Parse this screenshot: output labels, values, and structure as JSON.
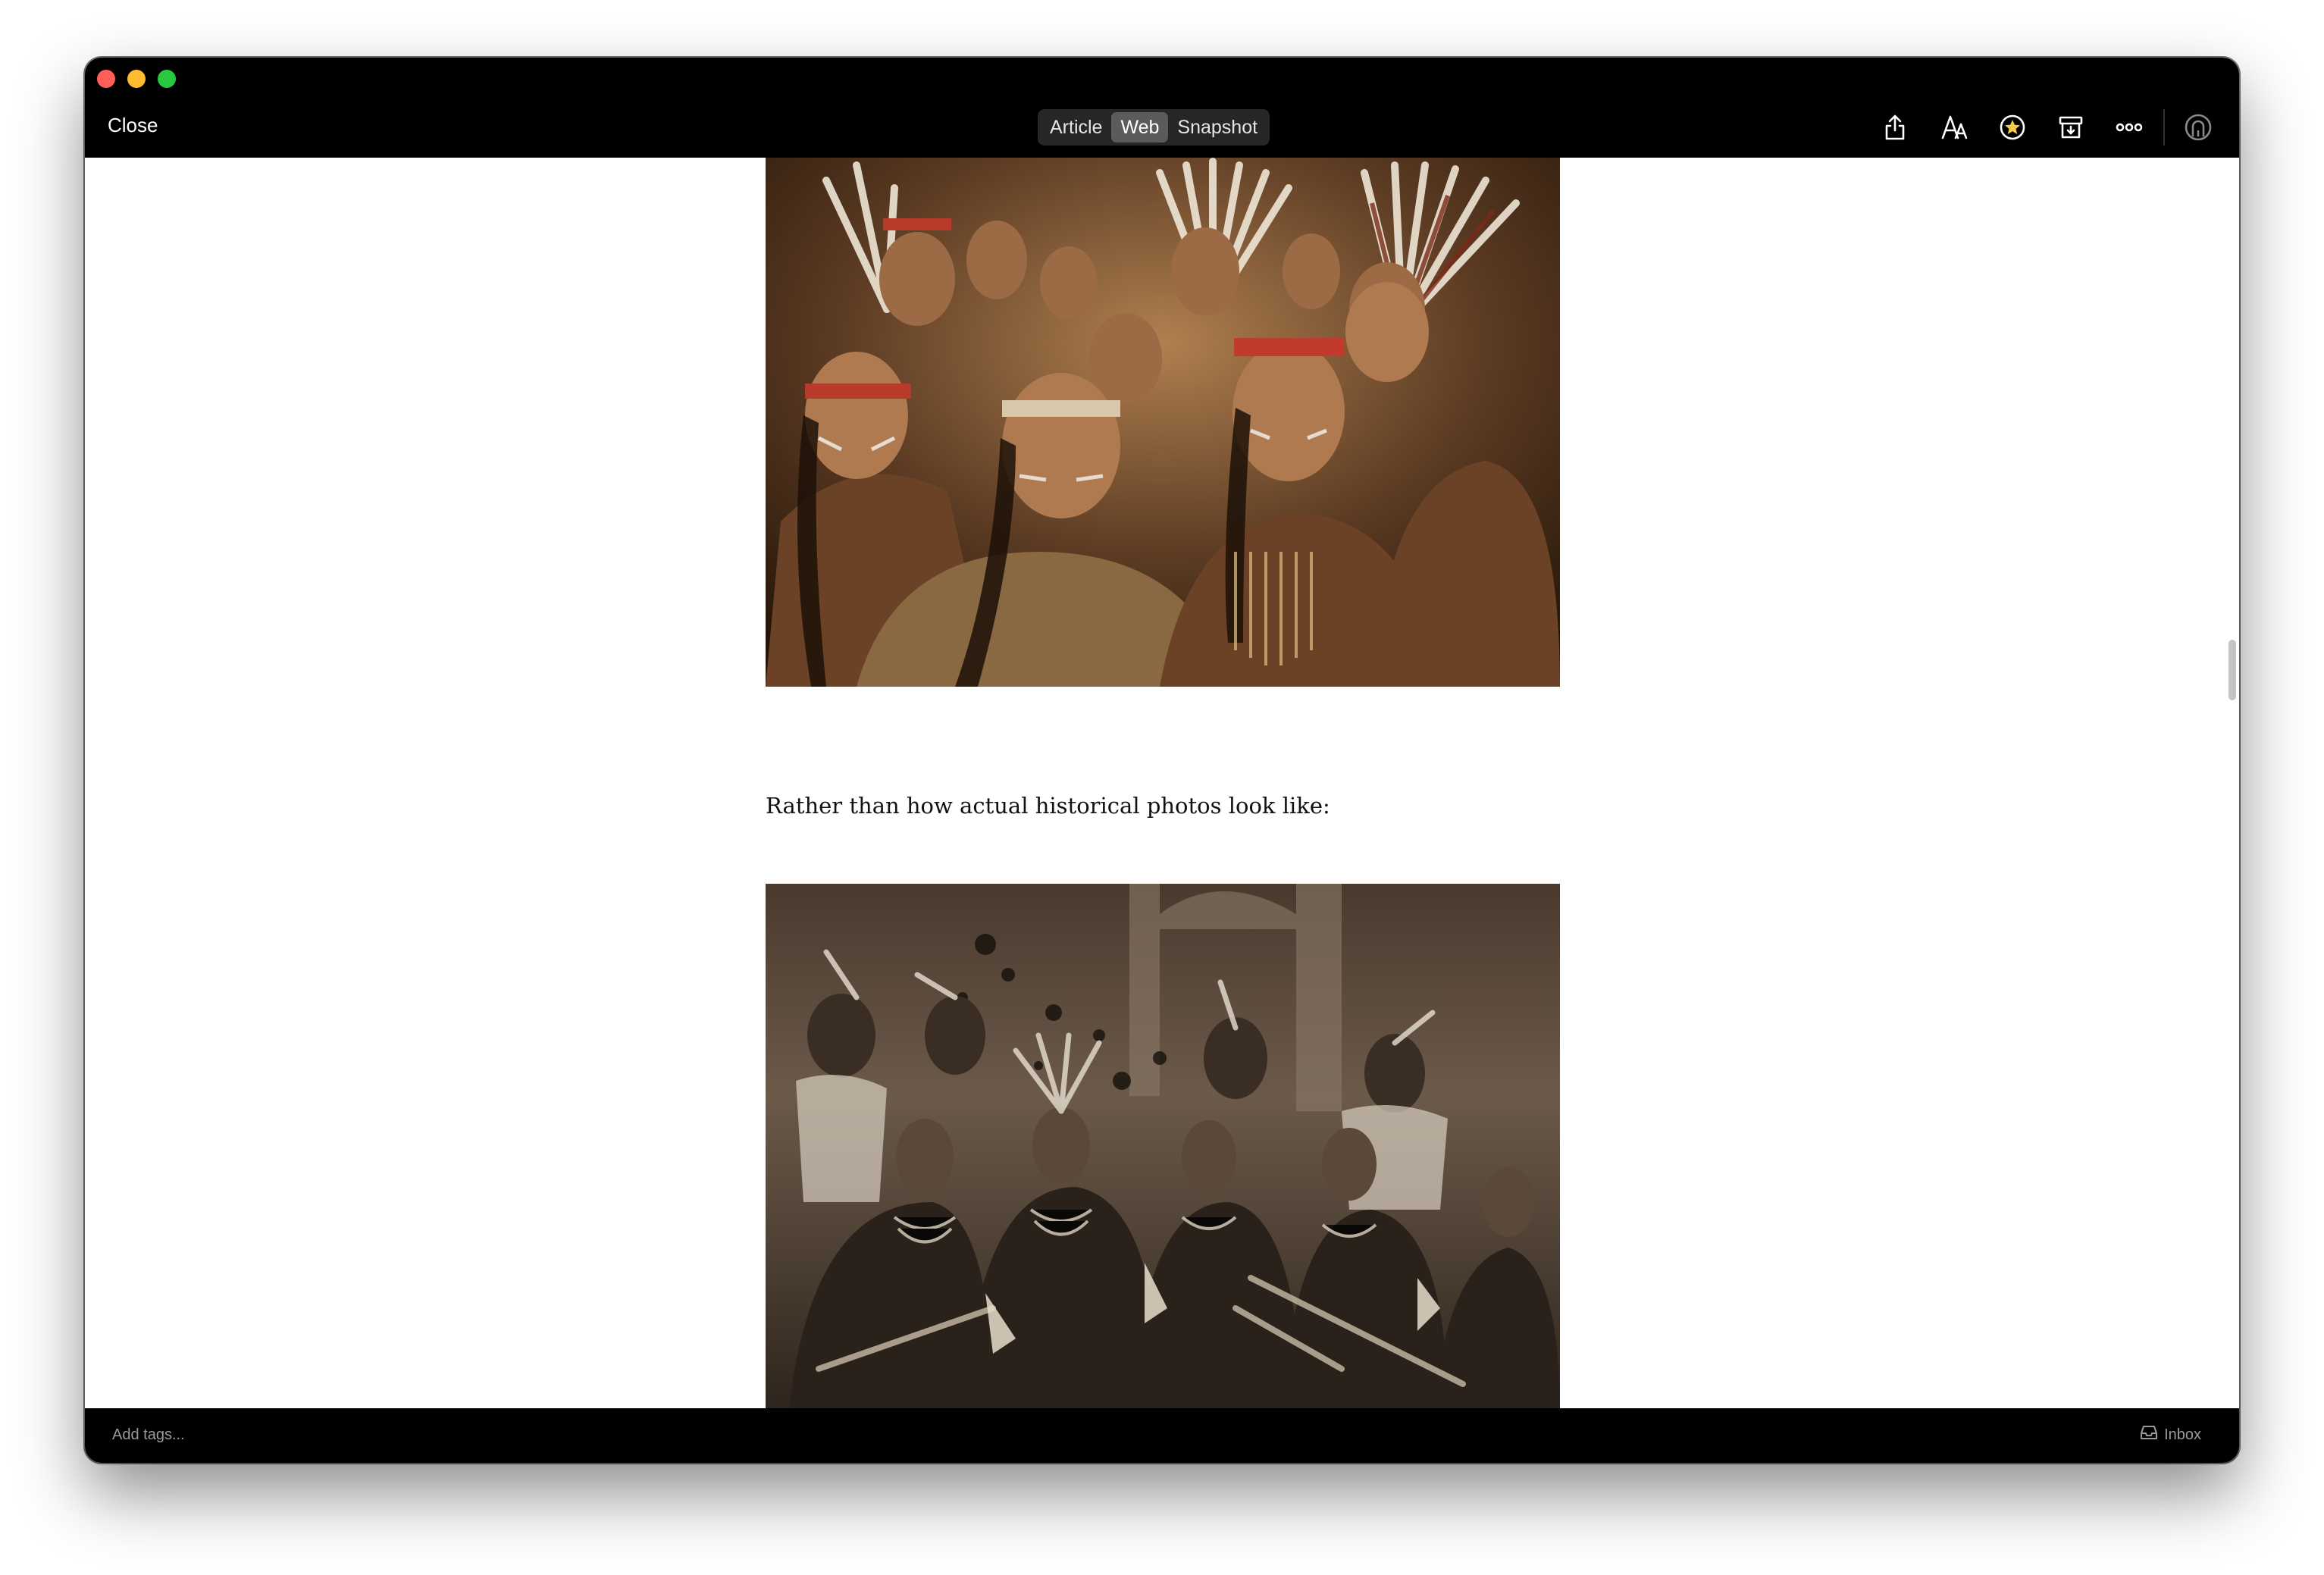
{
  "header": {
    "close_label": "Close",
    "view_tabs": [
      "Article",
      "Web",
      "Snapshot"
    ],
    "active_tab": "Web",
    "toolbar_icons": [
      "share-icon",
      "text-style-icon",
      "favorite-star-icon",
      "archive-icon",
      "more-icon",
      "account-icon"
    ]
  },
  "article": {
    "paragraph": "Rather than how actual historical photos look like:"
  },
  "footer": {
    "tags_placeholder": "Add tags...",
    "location_label": "Inbox"
  },
  "colors": {
    "titlebar": "#000000",
    "active_segment": "#5b5b5b",
    "star_accent": "#f2c94c"
  }
}
